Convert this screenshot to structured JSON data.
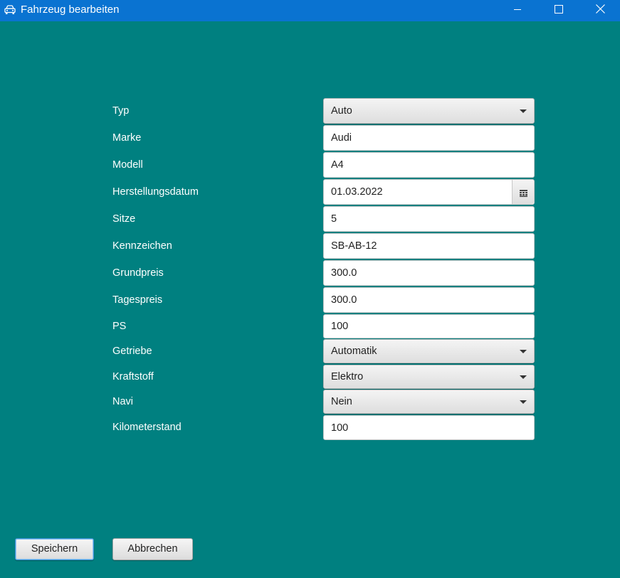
{
  "window": {
    "title": "Fahrzeug bearbeiten",
    "icon": "car-icon",
    "controls": [
      "minimize-icon",
      "maximize-icon",
      "close-icon"
    ]
  },
  "colors": {
    "titlebar": "#0a73d1",
    "background": "#008080",
    "label_text": "#ffffff"
  },
  "form": {
    "fields": [
      {
        "label": "Typ",
        "value": "Auto",
        "kind": "select"
      },
      {
        "label": "Marke",
        "value": "Audi",
        "kind": "text"
      },
      {
        "label": "Modell",
        "value": "A4",
        "kind": "text"
      },
      {
        "label": "Herstellungsdatum",
        "value": "01.03.2022",
        "kind": "date"
      },
      {
        "label": "Sitze",
        "value": "5",
        "kind": "text"
      },
      {
        "label": "Kennzeichen",
        "value": "SB-AB-12",
        "kind": "text"
      },
      {
        "label": "Grundpreis",
        "value": "300.0",
        "kind": "text"
      },
      {
        "label": "Tagespreis",
        "value": "300.0",
        "kind": "text"
      },
      {
        "label": "PS",
        "value": "100",
        "kind": "text"
      },
      {
        "label": "Getriebe",
        "value": "Automatik",
        "kind": "select"
      },
      {
        "label": "Kraftstoff",
        "value": "Elektro",
        "kind": "select"
      },
      {
        "label": "Navi",
        "value": "Nein",
        "kind": "select"
      },
      {
        "label": "Kilometerstand",
        "value": "100",
        "kind": "text"
      }
    ]
  },
  "buttons": {
    "save_label": "Speichern",
    "cancel_label": "Abbrechen"
  }
}
